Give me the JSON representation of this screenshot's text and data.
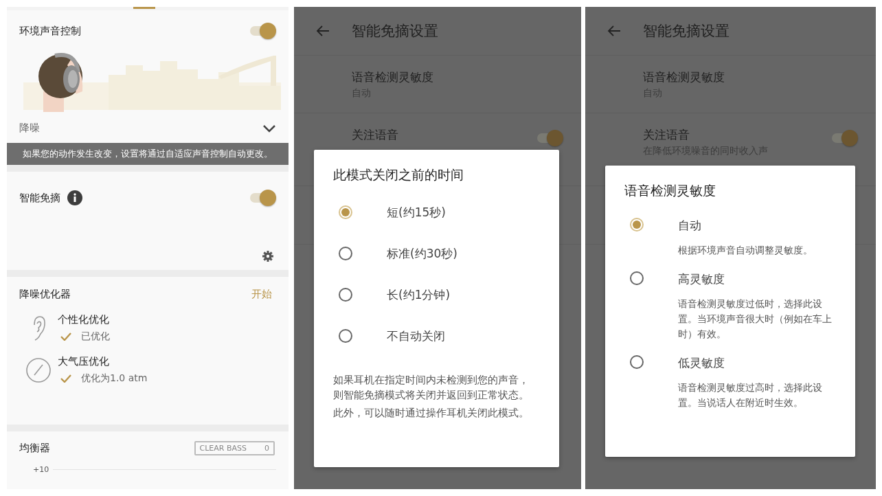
{
  "sound_panel": {
    "ambient_sound_control": {
      "title": "环境声音控制",
      "on": true,
      "mode": "降噪",
      "notice": "如果您的动作发生改变，设置将通过自适应声音控制自动更改。"
    },
    "speak_to_chat": {
      "title": "智能免摘",
      "on": true
    },
    "nc_optimizer": {
      "title": "降噪优化器",
      "action": "开始",
      "items": [
        {
          "kind": "ear",
          "title": "个性化优化",
          "status": "已优化"
        },
        {
          "kind": "gauge",
          "title": "大气压优化",
          "status": "优化为1.0 atm"
        }
      ]
    },
    "equalizer": {
      "title": "均衡器",
      "clear_bass_label": "CLEAR BASS",
      "clear_bass_value": "0",
      "axis_label": "+10"
    }
  },
  "timeout_panel": {
    "page": {
      "title": "智能免摘设置",
      "rows": [
        {
          "kind": "value",
          "title": "语音检测灵敏度",
          "subtitle": "自动"
        },
        {
          "kind": "toggle",
          "title": "关注语音",
          "on": true
        }
      ]
    },
    "dialog": {
      "title": "此模式关闭之前的时间",
      "options": [
        {
          "label": "短(约15秒)",
          "selected": true
        },
        {
          "label": "标准(约30秒)",
          "selected": false
        },
        {
          "label": "长(约1分钟)",
          "selected": false
        },
        {
          "label": "不自动关闭",
          "selected": false
        }
      ],
      "notes": [
        "如果耳机在指定时间内未检测到您的声音，则智能免摘模式将关闭并返回到正常状态。",
        "此外，可以随时通过操作耳机关闭此模式。"
      ]
    }
  },
  "sensitivity_panel": {
    "page": {
      "title": "智能免摘设置",
      "rows": [
        {
          "kind": "value",
          "title": "语音检测灵敏度",
          "subtitle": "自动"
        },
        {
          "kind": "toggle",
          "title": "关注语音",
          "subtitle": "在降低环境噪音的同时收入声",
          "on": true
        }
      ]
    },
    "dialog": {
      "title": "语音检测灵敏度",
      "options": [
        {
          "label": "自动",
          "selected": true,
          "description": "根据环境声音自动调整灵敏度。"
        },
        {
          "label": "高灵敏度",
          "selected": false,
          "description": "语音检测灵敏度过低时，选择此设置。当环境声音很大时（例如在车上时）有效。"
        },
        {
          "label": "低灵敏度",
          "selected": false,
          "description": "语音检测灵敏度过高时，选择此设置。当说话人在附近时生效。"
        }
      ]
    }
  }
}
